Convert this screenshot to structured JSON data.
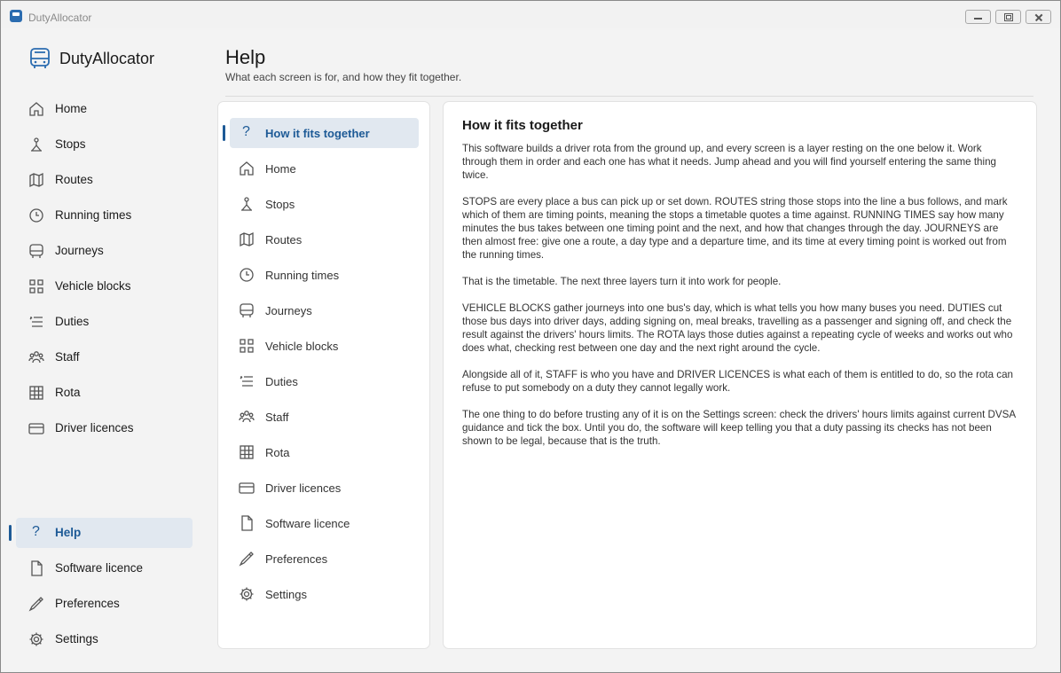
{
  "window": {
    "title": "DutyAllocator"
  },
  "sidebar": {
    "brand": "DutyAllocator",
    "items": [
      {
        "label": "Home",
        "icon": "home-icon"
      },
      {
        "label": "Stops",
        "icon": "stop-icon"
      },
      {
        "label": "Routes",
        "icon": "map-icon"
      },
      {
        "label": "Running times",
        "icon": "clock-icon"
      },
      {
        "label": "Journeys",
        "icon": "bus-icon"
      },
      {
        "label": "Vehicle blocks",
        "icon": "grid-icon"
      },
      {
        "label": "Duties",
        "icon": "list-icon"
      },
      {
        "label": "Staff",
        "icon": "people-icon"
      },
      {
        "label": "Rota",
        "icon": "table-icon"
      },
      {
        "label": "Driver licences",
        "icon": "card-icon"
      }
    ],
    "bottom_items": [
      {
        "label": "Help",
        "icon": "help-icon",
        "active": true
      },
      {
        "label": "Software licence",
        "icon": "document-icon"
      },
      {
        "label": "Preferences",
        "icon": "pen-icon"
      },
      {
        "label": "Settings",
        "icon": "gear-icon"
      }
    ]
  },
  "page": {
    "title": "Help",
    "subtitle": "What each screen is for, and how they fit together."
  },
  "toc": {
    "items": [
      {
        "label": "How it fits together",
        "icon": "help-icon",
        "active": true
      },
      {
        "label": "Home",
        "icon": "home-icon"
      },
      {
        "label": "Stops",
        "icon": "stop-icon"
      },
      {
        "label": "Routes",
        "icon": "map-icon"
      },
      {
        "label": "Running times",
        "icon": "clock-icon"
      },
      {
        "label": "Journeys",
        "icon": "bus-icon"
      },
      {
        "label": "Vehicle blocks",
        "icon": "grid-icon"
      },
      {
        "label": "Duties",
        "icon": "list-icon"
      },
      {
        "label": "Staff",
        "icon": "people-icon"
      },
      {
        "label": "Rota",
        "icon": "table-icon"
      },
      {
        "label": "Driver licences",
        "icon": "card-icon"
      },
      {
        "label": "Software licence",
        "icon": "document-icon"
      },
      {
        "label": "Preferences",
        "icon": "pen-icon"
      },
      {
        "label": "Settings",
        "icon": "gear-icon"
      }
    ]
  },
  "article": {
    "heading": "How it fits together",
    "paragraphs": [
      "This software builds a driver rota from the ground up, and every screen is a layer resting on the one below it. Work through them in order and each one has what it needs. Jump ahead and you will find yourself entering the same thing twice.",
      "STOPS are every place a bus can pick up or set down. ROUTES string those stops into the line a bus follows, and mark which of them are timing points, meaning the stops a timetable quotes a time against. RUNNING TIMES say how many minutes the bus takes between one timing point and the next, and how that changes through the day. JOURNEYS are then almost free: give one a route, a day type and a departure time, and its time at every timing point is worked out from the running times.",
      "That is the timetable. The next three layers turn it into work for people.",
      "VEHICLE BLOCKS gather journeys into one bus's day, which is what tells you how many buses you need. DUTIES cut those bus days into driver days, adding signing on, meal breaks, travelling as a passenger and signing off, and check the result against the drivers' hours limits. The ROTA lays those duties against a repeating cycle of weeks and works out who does what, checking rest between one day and the next right around the cycle.",
      "Alongside all of it, STAFF is who you have and DRIVER LICENCES is what each of them is entitled to do, so the rota can refuse to put somebody on a duty they cannot legally work.",
      "The one thing to do before trusting any of it is on the Settings screen: check the drivers' hours limits against current DVSA guidance and tick the box. Until you do, the software will keep telling you that a duty passing its checks has not been shown to be legal, because that is the truth."
    ]
  },
  "colors": {
    "accent": "#1d5a96",
    "active_bg": "#e1e8f0",
    "window_bg": "#f3f3f3"
  }
}
